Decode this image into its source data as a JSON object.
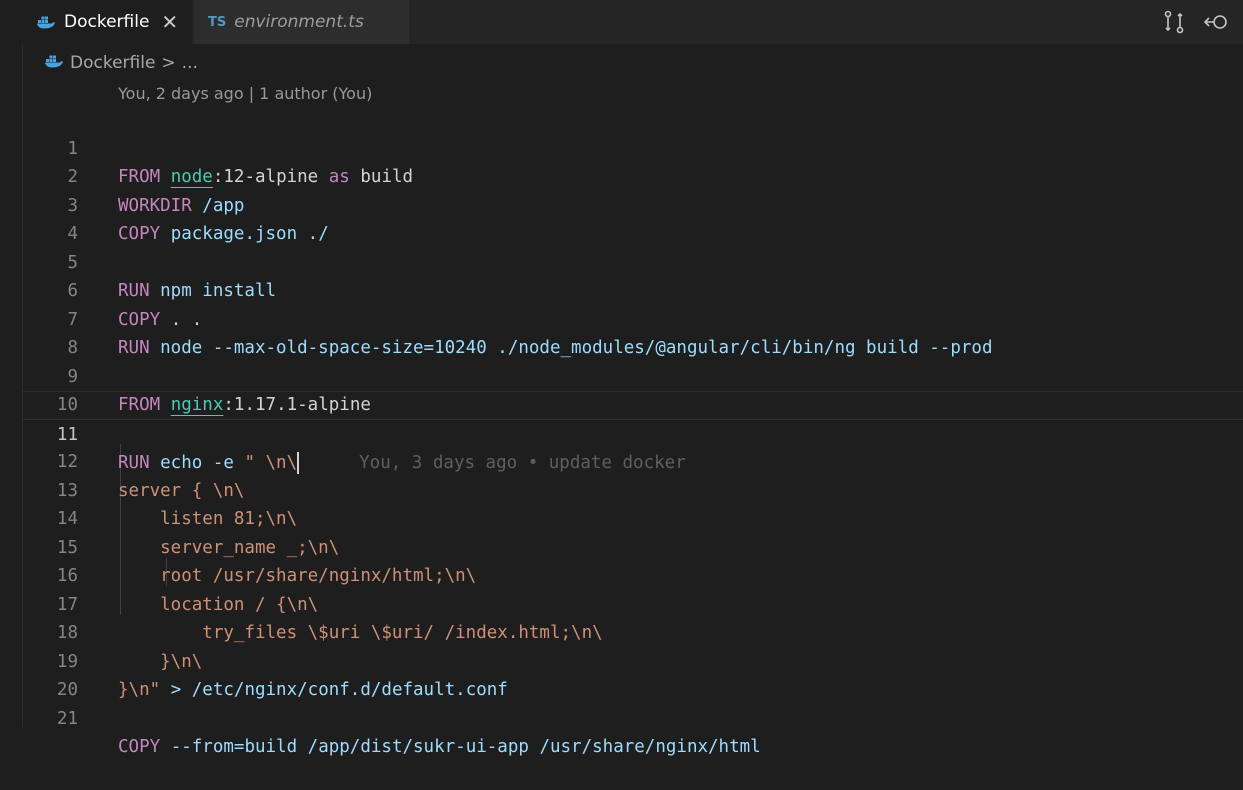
{
  "tabs": [
    {
      "label": "Dockerfile",
      "icon": "docker-icon",
      "active": true,
      "close": "✕"
    },
    {
      "label": "environment.ts",
      "icon": "ts-icon",
      "icon_text": "TS",
      "active": false
    }
  ],
  "tab_actions": [
    "git-compare-icon",
    "go-back-icon"
  ],
  "breadcrumb": {
    "file": "Dockerfile",
    "separator": ">",
    "more": "..."
  },
  "codelens": "You, 2 days ago | 1 author (You)",
  "blame_line_11": "You, 3 days ago • update docker",
  "lines": [
    {
      "n": "1"
    },
    {
      "n": "2"
    },
    {
      "n": "3"
    },
    {
      "n": "4"
    },
    {
      "n": "5"
    },
    {
      "n": "6"
    },
    {
      "n": "7"
    },
    {
      "n": "8"
    },
    {
      "n": "9"
    },
    {
      "n": "10"
    },
    {
      "n": "11"
    },
    {
      "n": "12"
    },
    {
      "n": "13"
    },
    {
      "n": "14"
    },
    {
      "n": "15"
    },
    {
      "n": "16"
    },
    {
      "n": "17"
    },
    {
      "n": "18"
    },
    {
      "n": "19"
    },
    {
      "n": "20"
    },
    {
      "n": "21"
    }
  ],
  "code": {
    "l1": [
      "FROM",
      " ",
      "node",
      ":12-alpine ",
      "as",
      " build"
    ],
    "l2": [
      "WORKDIR",
      " /app"
    ],
    "l3": [
      "COPY",
      " package.json ./"
    ],
    "l5": [
      "RUN",
      " npm install"
    ],
    "l6": [
      "COPY",
      " . ."
    ],
    "l7": [
      "RUN",
      " node --max-old-space-size=10240 ./node_modules/@angular/cli/bin/ng build --prod"
    ],
    "l9": [
      "FROM",
      " ",
      "nginx",
      ":1.17.1-alpine"
    ],
    "l11": [
      "RUN",
      " echo -e ",
      "\" \\n\\"
    ],
    "l12": "server { \\n\\",
    "l13": "    listen 81;\\n\\",
    "l14": "    server_name _;\\n\\",
    "l15": "    root /usr/share/nginx/html;\\n\\",
    "l16": "    location / {\\n\\",
    "l17": "        try_files \\$uri \\$uri/ /index.html;\\n\\",
    "l18": "    }\\n\\",
    "l19": [
      "}\\n\"",
      " > /etc/nginx/conf.d/default.conf"
    ],
    "l21": [
      "COPY",
      " --from=build /app/dist/sukr-ui-app /usr/share/nginx/html"
    ]
  },
  "colors": {
    "keyword": "#c586c0",
    "identifier": "#9cdcfe",
    "image": "#4ec9b0",
    "string": "#ce9178",
    "background": "#1e1e1e"
  }
}
